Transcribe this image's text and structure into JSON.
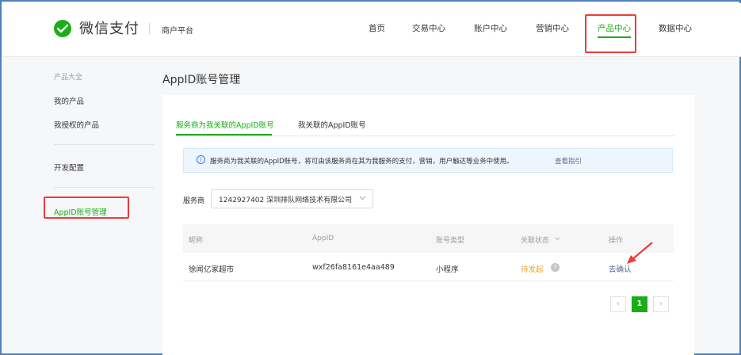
{
  "header": {
    "brand": "微信支付",
    "platform": "商户平台",
    "nav": [
      {
        "label": "首页"
      },
      {
        "label": "交易中心"
      },
      {
        "label": "账户中心"
      },
      {
        "label": "营销中心"
      },
      {
        "label": "产品中心"
      },
      {
        "label": "数据中心"
      }
    ],
    "active_nav": "产品中心"
  },
  "sidebar": {
    "group_title": "产品大全",
    "items": [
      {
        "label": "我的产品"
      },
      {
        "label": "我授权的产品"
      },
      {
        "label": "开发配置"
      },
      {
        "label": "AppID账号管理"
      }
    ],
    "active_item": "AppID账号管理"
  },
  "main": {
    "title": "AppID账号管理",
    "tabs": [
      {
        "label": "服务商为我关联的AppID账号"
      },
      {
        "label": "我关联的AppID账号"
      }
    ],
    "notice": {
      "icon": "info-icon",
      "text": "服务商为我关联的AppID账号，将可由该服务商在其为我服务的支付，营销，用户触达等业务中使用。",
      "link": "查看指引"
    },
    "filter": {
      "label": "服务商",
      "selected": "1242927402  深圳排队网络技术有限公司"
    },
    "table": {
      "columns": [
        "昵称",
        "AppID",
        "账号类型",
        "关联状态",
        "操作"
      ],
      "rows": [
        {
          "nickname": "徐闻亿家超市",
          "appid": "wxf26fa8161e4aa489",
          "type": "小程序",
          "status": "待发起",
          "action": "去确认"
        }
      ]
    },
    "pagination": {
      "prev": "‹",
      "current": "1",
      "next": "›"
    }
  },
  "colors": {
    "accent": "#1aad19",
    "link": "#576b95",
    "status_pending": "#f0a12d",
    "annotation": "#ef3b3b"
  }
}
